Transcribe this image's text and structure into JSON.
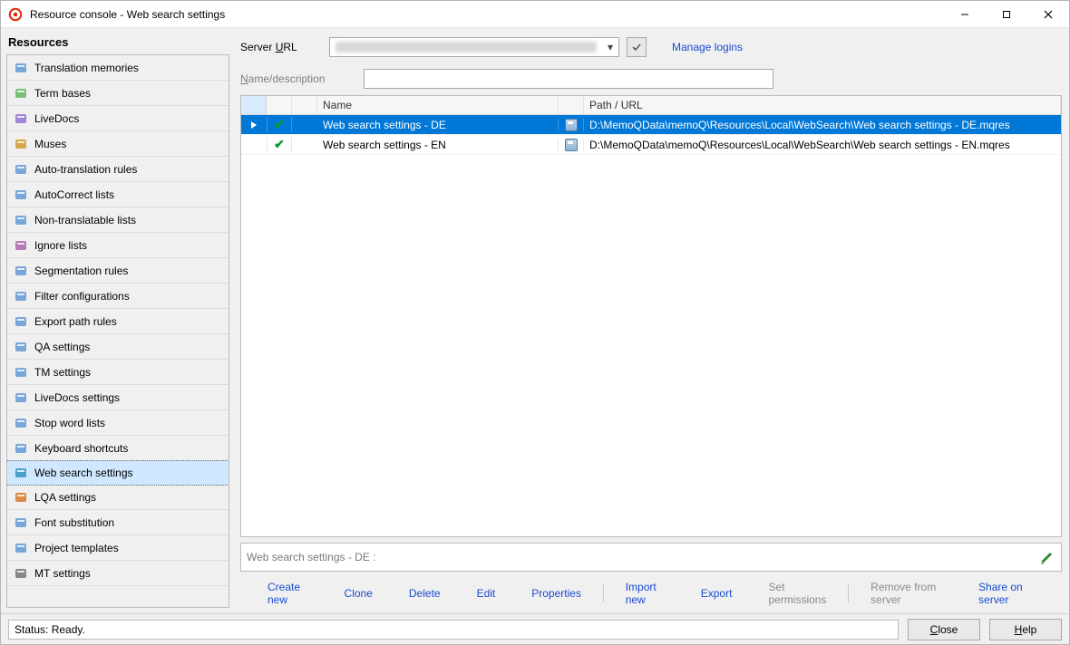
{
  "window": {
    "title": "Resource console - Web search settings"
  },
  "sidebar": {
    "header": "Resources",
    "items": [
      {
        "label": "Translation memories",
        "selected": false
      },
      {
        "label": "Term bases",
        "selected": false
      },
      {
        "label": "LiveDocs",
        "selected": false
      },
      {
        "label": "Muses",
        "selected": false
      },
      {
        "label": "Auto-translation rules",
        "selected": false
      },
      {
        "label": "AutoCorrect lists",
        "selected": false
      },
      {
        "label": "Non-translatable lists",
        "selected": false
      },
      {
        "label": "Ignore lists",
        "selected": false
      },
      {
        "label": "Segmentation rules",
        "selected": false
      },
      {
        "label": "Filter configurations",
        "selected": false
      },
      {
        "label": "Export path rules",
        "selected": false
      },
      {
        "label": "QA settings",
        "selected": false
      },
      {
        "label": "TM settings",
        "selected": false
      },
      {
        "label": "LiveDocs settings",
        "selected": false
      },
      {
        "label": "Stop word lists",
        "selected": false
      },
      {
        "label": "Keyboard shortcuts",
        "selected": false
      },
      {
        "label": "Web search settings",
        "selected": true
      },
      {
        "label": "LQA settings",
        "selected": false
      },
      {
        "label": "Font substitution",
        "selected": false
      },
      {
        "label": "Project templates",
        "selected": false
      },
      {
        "label": "MT settings",
        "selected": false
      }
    ]
  },
  "toolbar": {
    "server_label_pre": "Server ",
    "server_label_u": "U",
    "server_label_post": "RL",
    "manage_logins": "Manage logins"
  },
  "filter": {
    "label_u": "N",
    "label_post": "ame/description"
  },
  "grid": {
    "headers": {
      "name": "Name",
      "path": "Path / URL"
    },
    "rows": [
      {
        "selected": true,
        "checked": true,
        "name": "Web search settings - DE",
        "path": "D:\\MemoQData\\memoQ\\Resources\\Local\\WebSearch\\Web search settings - DE.mqres"
      },
      {
        "selected": false,
        "checked": true,
        "name": "Web search settings - EN",
        "path": "D:\\MemoQData\\memoQ\\Resources\\Local\\WebSearch\\Web search settings - EN.mqres"
      }
    ]
  },
  "detail": {
    "text": "Web search settings - DE :"
  },
  "actions": {
    "create_new": "Create new",
    "clone": "Clone",
    "delete": "Delete",
    "edit": "Edit",
    "properties": "Properties",
    "import_new": "Import new",
    "export": "Export",
    "set_permissions": "Set permissions",
    "remove_from_server": "Remove from server",
    "share_on_server": "Share on server"
  },
  "footer": {
    "status": "Status: Ready.",
    "close_u": "C",
    "close_post": "lose",
    "help_u": "H",
    "help_post": "elp"
  }
}
